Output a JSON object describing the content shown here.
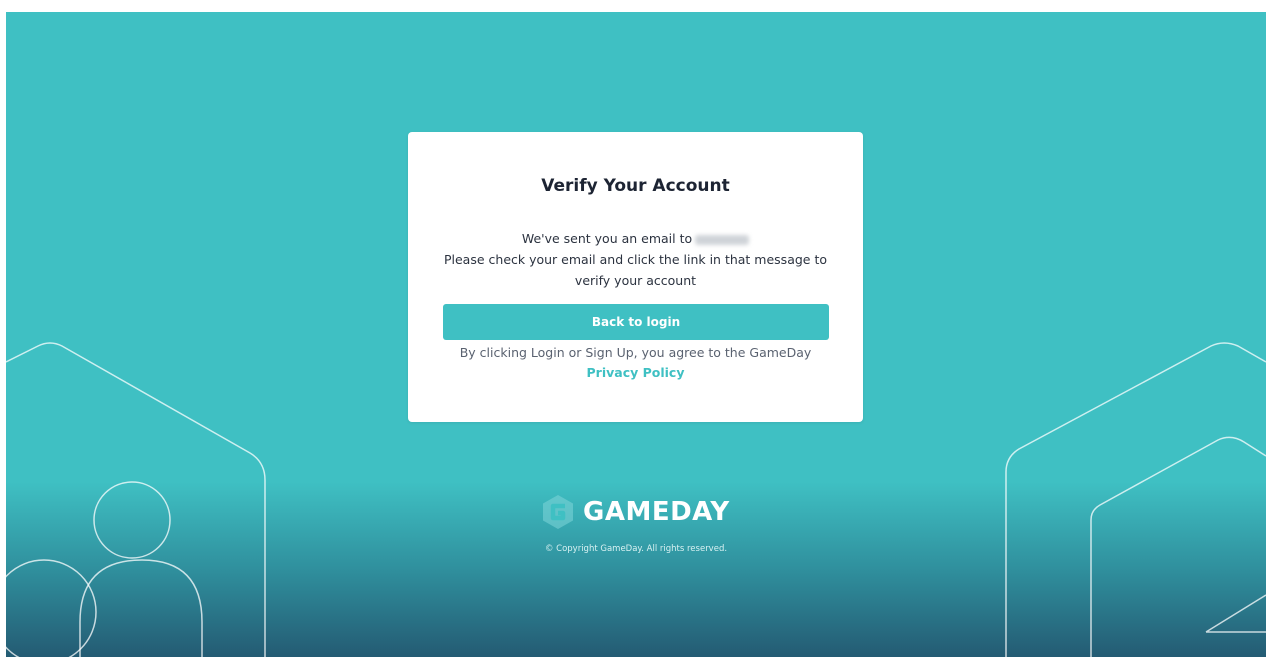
{
  "card": {
    "title": "Verify Your Account",
    "sent_prefix": "We've sent you an email to",
    "email_obscured": "blurred email address",
    "instruction": "Please check your email and click the link in that message to verify your account",
    "back_button_label": "Back to login",
    "legal_prefix": "By clicking Login or Sign Up, you agree to the GameDay ",
    "privacy_link_label": "Privacy Policy"
  },
  "footer": {
    "brand_name": "GAMEDAY",
    "logo_icon": "gameday-g-logo-icon",
    "copyright": "© Copyright GameDay. All rights reserved."
  },
  "colors": {
    "background_teal": "#3fc0c3",
    "background_dark": "#245b73",
    "accent": "#3fc0c3",
    "card_bg": "#ffffff",
    "title_text": "#1d2433"
  }
}
